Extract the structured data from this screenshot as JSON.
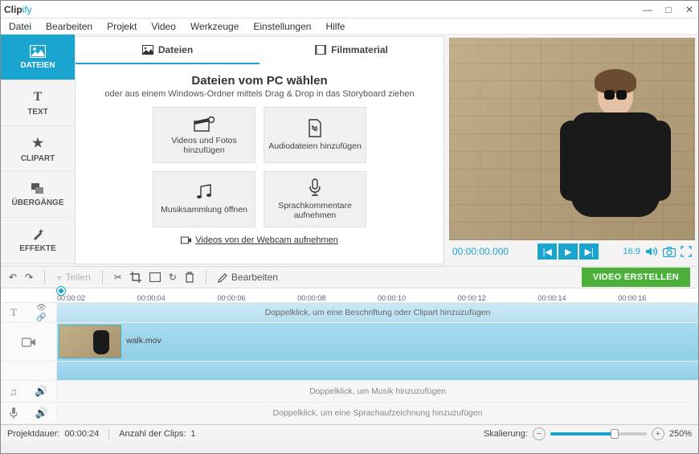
{
  "app": {
    "name_prefix": "Clip",
    "name_suffix": "ify"
  },
  "menu": [
    "Datei",
    "Bearbeiten",
    "Projekt",
    "Video",
    "Werkzeuge",
    "Einstellungen",
    "Hilfe"
  ],
  "sidebar": [
    {
      "label": "DATEIEN",
      "icon": "image"
    },
    {
      "label": "TEXT",
      "icon": "T"
    },
    {
      "label": "CLIPART",
      "icon": "★"
    },
    {
      "label": "ÜBERGÄNGE",
      "icon": "layers"
    },
    {
      "label": "EFFEKTE",
      "icon": "wand"
    }
  ],
  "media": {
    "tab_files": "Dateien",
    "tab_stock": "Filmmaterial",
    "title": "Dateien vom PC wählen",
    "subtitle": "oder aus einem Windows-Ordner mittels Drag & Drop in das Storyboard ziehen",
    "tiles": [
      {
        "label": "Videos und Fotos hinzufügen",
        "icon": "clapper"
      },
      {
        "label": "Audiodateien hinzufügen",
        "icon": "audiofile"
      },
      {
        "label": "Musiksammlung öffnen",
        "icon": "music"
      },
      {
        "label": "Sprachkommentare aufnehmen",
        "icon": "mic"
      }
    ],
    "webcam": "Videos von der Webcam aufnehmen"
  },
  "preview": {
    "timecode": "00:00:00.000",
    "aspect": "16:9"
  },
  "toolbar": {
    "split": "Teilen",
    "edit": "Bearbeiten",
    "create": "VIDEO ERSTELLEN"
  },
  "ruler": [
    "00:00:02",
    "00:00:04",
    "00:00:06",
    "00:00:08",
    "00:00:10",
    "00:00:12",
    "00:00:14",
    "00:00:16"
  ],
  "tracks": {
    "caption_hint": "Doppelklick, um eine Beschriftung oder Clipart hinzuzufügen",
    "clip_name": "walk.mov",
    "music_hint": "Doppelklick, um Musik hinzuzufügen",
    "voice_hint": "Doppelklick, um eine Sprachaufzeichnung hinzuzufügen"
  },
  "status": {
    "duration_label": "Projektdauer:",
    "duration": "00:00:24",
    "clips_label": "Anzahl der Clips:",
    "clips": "1",
    "scale_label": "Skalierung:",
    "scale_value": "250%"
  }
}
